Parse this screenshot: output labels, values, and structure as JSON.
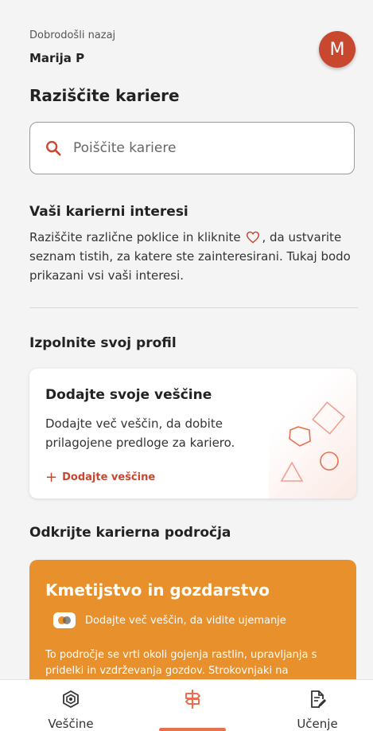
{
  "header": {
    "welcome": "Dobrodošli nazaj",
    "username": "Marija P",
    "avatar_initial": "M"
  },
  "page_title": "Raziščite kariere",
  "search": {
    "placeholder": "Poiščite kariere"
  },
  "interests": {
    "title": "Vaši karierni interesi",
    "text_before": "Raziščite različne poklice in kliknite",
    "text_after": ", da ustvarite seznam tistih, za katere ste zainteresirani. Tukaj bodo prikazani vsi vaši interesi."
  },
  "profile": {
    "section_title": "Izpolnite svoj profil",
    "card_title": "Dodajte svoje veščine",
    "card_text": "Dodajte več veščin, da dobite prilagojene predloge za kariero.",
    "card_action": "Dodajte veščine"
  },
  "areas": {
    "section_title": "Odkrijte karierna področja",
    "card_title": "Kmetijstvo in gozdarstvo",
    "match_text": "Dodajte več veščin, da vidite ujemanje",
    "description": "To področje se vrti okoli gojenja rastlin, upravljanja s pridelki in vzdrževanja gozdov. Strokovnjaki na"
  },
  "nav": {
    "skills": "Veščine",
    "learning": "Učenje"
  },
  "colors": {
    "accent": "#c8472f",
    "area_card": "#e8902c",
    "background": "#f4f4f5"
  }
}
